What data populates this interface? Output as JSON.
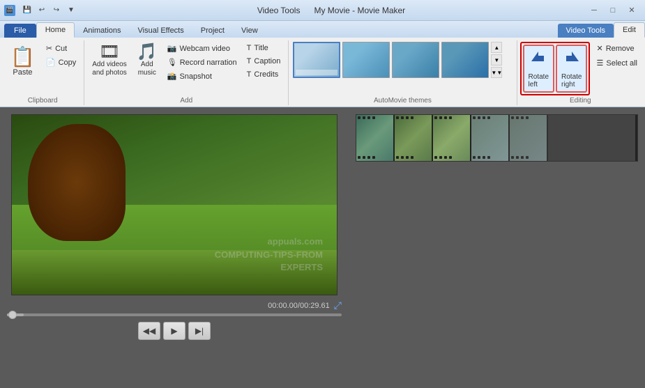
{
  "titlebar": {
    "app_title": "My Movie - Movie Maker",
    "video_tools_label": "Video Tools"
  },
  "ribbon_tabs": {
    "file": "File",
    "home": "Home",
    "animations": "Animations",
    "visual_effects": "Visual Effects",
    "project": "Project",
    "view": "View",
    "video_tools": "Video Tools",
    "edit": "Edit"
  },
  "clipboard_group": {
    "label": "Clipboard",
    "paste": "Paste",
    "cut": "Cut",
    "copy": "Copy"
  },
  "add_group": {
    "label": "Add",
    "add_videos": "Add videos\nand photos",
    "add_music": "Add\nmusic",
    "webcam_video": "Webcam video",
    "record_narration": "Record narration",
    "snapshot": "Snapshot",
    "title": "Title",
    "caption": "Caption",
    "credits": "Credits"
  },
  "automovie_group": {
    "label": "AutoMovie themes",
    "themes": [
      "t1",
      "t2",
      "t3",
      "t4"
    ]
  },
  "editing_group": {
    "label": "Editing",
    "rotate_left": "Rotate\nleft",
    "rotate_right": "Rotate\nright",
    "remove": "Remove",
    "select_all": "Select all"
  },
  "playback": {
    "time": "00:00.00/00:29.61"
  },
  "watermark": {
    "line1": "appuals.com",
    "line2": "COMPUTING-TIPS-FROM",
    "line3": "EXPERTS"
  }
}
